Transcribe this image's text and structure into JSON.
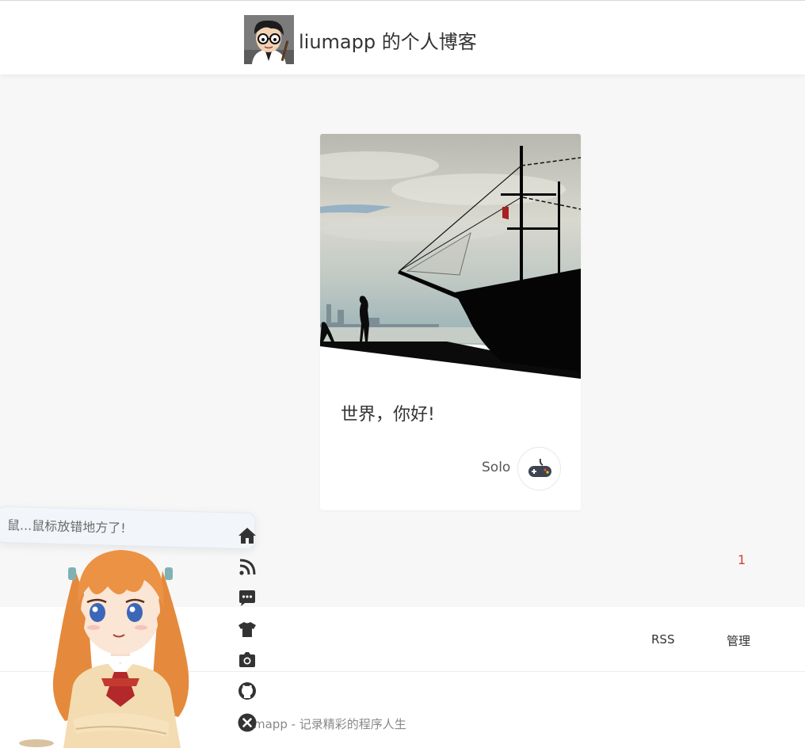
{
  "header": {
    "site_title": "liumapp 的个人博客",
    "avatar_icon": "cartoon-avatar-icon"
  },
  "article": {
    "title": "世界，你好!",
    "author": "Solo",
    "author_avatar_icon": "gamepad-icon",
    "cover_icon": "pirate-ship-cover-image"
  },
  "pagination": {
    "current_page": "1"
  },
  "footer": {
    "links": {
      "rss": "RSS",
      "admin": "管理"
    },
    "copyright": "mapp - 记录精彩的程序人生"
  },
  "waifu": {
    "tip": "鼠...鼠标放错地方了!",
    "tools": [
      "home-icon",
      "rss-icon",
      "chat-icon",
      "shirt-icon",
      "camera-icon",
      "github-icon",
      "close-icon"
    ]
  },
  "colors": {
    "accent": "#d23f31",
    "icon_dark": "#333333",
    "background": "#f7f7f7"
  }
}
